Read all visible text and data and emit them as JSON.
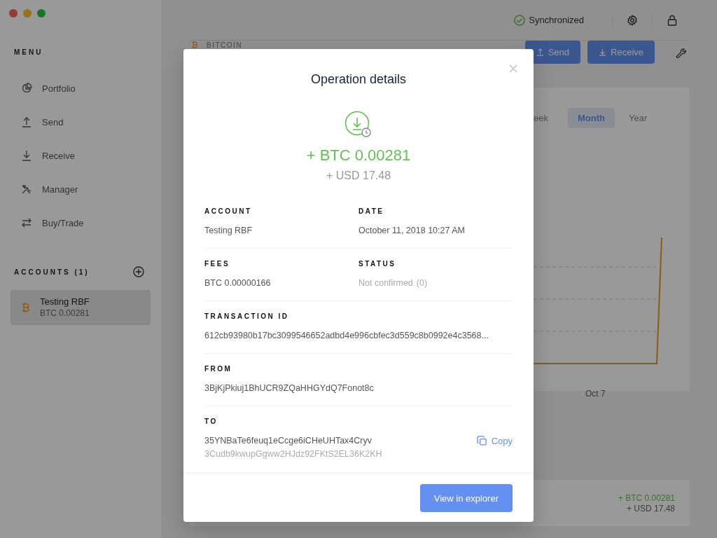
{
  "sidebar": {
    "menu_title": "MENU",
    "items": [
      {
        "label": "Portfolio"
      },
      {
        "label": "Send"
      },
      {
        "label": "Receive"
      },
      {
        "label": "Manager"
      },
      {
        "label": "Buy/Trade"
      }
    ],
    "accounts_title": "ACCOUNTS (1)",
    "accounts": [
      {
        "name": "Testing RBF",
        "balance": "BTC 0.00281",
        "selected": true
      }
    ]
  },
  "top_bar": {
    "sync_status": "Synchronized"
  },
  "account_header": {
    "currency": "BITCOIN",
    "buttons": [
      "Send",
      "Receive"
    ]
  },
  "chart_card": {
    "ranges": [
      {
        "label": "eek",
        "selected": false
      },
      {
        "label": "Month",
        "selected": true
      },
      {
        "label": "Year",
        "selected": false
      }
    ],
    "x_label": "Oct 7"
  },
  "operation_row": {
    "amount": "+ BTC 0.00281",
    "fiat": "+ USD 17.48"
  },
  "modal": {
    "title": "Operation details",
    "amount": "+ BTC 0.00281",
    "fiat": "+ USD 17.48",
    "rows": [
      [
        {
          "label": "ACCOUNT",
          "value": "Testing RBF",
          "confirmed": true
        },
        {
          "label": "DATE",
          "value": "October 11, 2018 10:27 AM",
          "confirmed": true
        }
      ],
      [
        {
          "label": "FEES",
          "value": "BTC 0.00000166",
          "confirmed": true
        },
        {
          "label": "STATUS",
          "value": "Not confirmed",
          "count": "(0)",
          "confirmed": false
        }
      ],
      [
        {
          "label": "TRANSACTION ID",
          "value": "612cb93980b17bc3099546652adbd4e996cbfec3d559c8b0992e4c3568...",
          "confirmed": true
        }
      ],
      [
        {
          "label": "FROM",
          "value": "3BjKjPkiuj1BhUCR9ZQaHHGYdQ7Fonot8c",
          "confirmed": true
        }
      ]
    ],
    "to": {
      "label": "TO",
      "addresses": [
        {
          "value": "35YNBaTe6feuq1eCcge6iCHeUHTax4Cryv",
          "primary": true
        },
        {
          "value": "3Cudb9kwupGgww2HJdz92FKtS2EL36K2KH",
          "primary": false
        }
      ],
      "copy": "Copy"
    },
    "button": "View in explorer"
  }
}
